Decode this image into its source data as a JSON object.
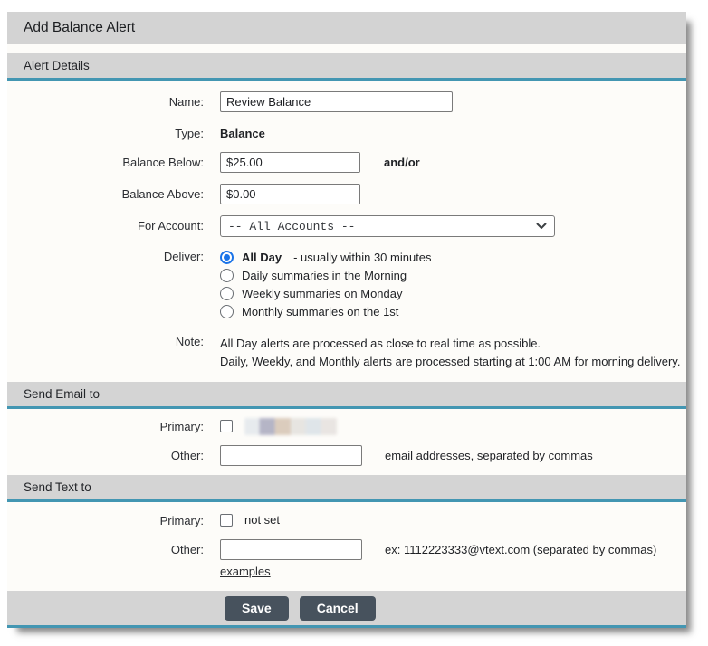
{
  "dialog": {
    "title": "Add Balance Alert"
  },
  "alert_details": {
    "heading": "Alert Details",
    "name_label": "Name:",
    "name_value": "Review Balance",
    "type_label": "Type:",
    "type_value": "Balance",
    "balance_below_label": "Balance Below:",
    "balance_below_value": "$25.00",
    "and_or": "and/or",
    "balance_above_label": "Balance Above:",
    "balance_above_value": "$0.00",
    "for_account_label": "For Account:",
    "for_account_selected": "-- All Accounts --",
    "deliver_label": "Deliver:",
    "deliver_options": [
      {
        "label": "All Day",
        "detail": "- usually within 30 minutes",
        "selected": true
      },
      {
        "label": "Daily summaries in the Morning",
        "detail": "",
        "selected": false
      },
      {
        "label": "Weekly summaries on Monday",
        "detail": "",
        "selected": false
      },
      {
        "label": "Monthly summaries on the 1st",
        "detail": "",
        "selected": false
      }
    ],
    "note_label": "Note:",
    "note_line1": "All Day alerts are processed as close to real time as possible.",
    "note_line2": "Daily, Weekly, and Monthly alerts are processed starting at 1:00 AM for morning delivery."
  },
  "send_email": {
    "heading": "Send Email to",
    "primary_label": "Primary:",
    "other_label": "Other:",
    "other_value": "",
    "other_hint": "email addresses, separated by commas"
  },
  "send_text": {
    "heading": "Send Text to",
    "primary_label": "Primary:",
    "primary_value": "not set",
    "other_label": "Other:",
    "other_value": "",
    "other_hint": "ex: 1112223333@vtext.com (separated by commas)",
    "examples_link": "examples"
  },
  "actions": {
    "save": "Save",
    "cancel": "Cancel"
  },
  "colors": {
    "section_bar": "#d3d3d3",
    "accent_line": "#4396b2",
    "radio_selected": "#1a73e8",
    "button_bg": "#47525d"
  }
}
